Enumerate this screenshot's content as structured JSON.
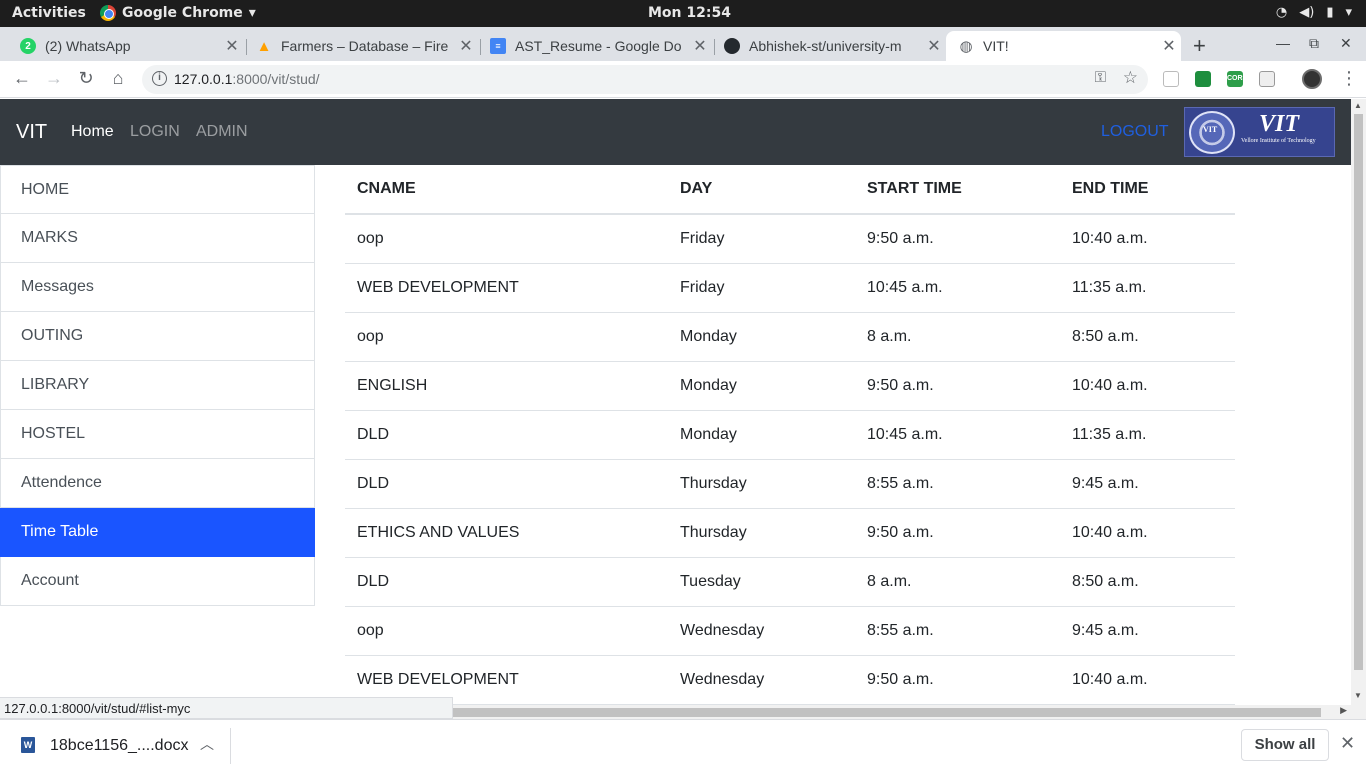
{
  "system_bar": {
    "activities": "Activities",
    "app_menu": "Google Chrome",
    "clock": "Mon 12:54"
  },
  "tabs": [
    {
      "title": "(2) WhatsApp",
      "badge": "2"
    },
    {
      "title": "Farmers – Database – Fire"
    },
    {
      "title": "AST_Resume - Google Do"
    },
    {
      "title": "Abhishek-st/university-m"
    },
    {
      "title": "VIT!"
    }
  ],
  "address_bar": {
    "url_host": "127.0.0.1",
    "url_rest": ":8000/vit/stud/"
  },
  "extensions": {
    "cors_label": "CORS"
  },
  "navbar": {
    "brand": "VIT",
    "links": [
      "Home",
      "LOGIN",
      "ADMIN"
    ],
    "logout": "LOGOUT",
    "logo_text": "VIT",
    "logo_subtitle": "Vellore Institute of Technology",
    "logo_seal_text": "VIT"
  },
  "sidebar": {
    "items": [
      "HOME",
      "MARKS",
      "Messages",
      "OUTING",
      "LIBRARY",
      "HOSTEL",
      "Attendence",
      "Time Table",
      "Account"
    ],
    "active": "Time Table"
  },
  "timetable": {
    "headers": [
      "CNAME",
      "DAY",
      "START TIME",
      "END TIME"
    ],
    "rows": [
      [
        "oop",
        "Friday",
        "9:50 a.m.",
        "10:40 a.m."
      ],
      [
        "WEB DEVELOPMENT",
        "Friday",
        "10:45 a.m.",
        "11:35 a.m."
      ],
      [
        "oop",
        "Monday",
        "8 a.m.",
        "8:50 a.m."
      ],
      [
        "ENGLISH",
        "Monday",
        "9:50 a.m.",
        "10:40 a.m."
      ],
      [
        "DLD",
        "Monday",
        "10:45 a.m.",
        "11:35 a.m."
      ],
      [
        "DLD",
        "Thursday",
        "8:55 a.m.",
        "9:45 a.m."
      ],
      [
        "ETHICS AND VALUES",
        "Thursday",
        "9:50 a.m.",
        "10:40 a.m."
      ],
      [
        "DLD",
        "Tuesday",
        "8 a.m.",
        "8:50 a.m."
      ],
      [
        "oop",
        "Wednesday",
        "8:55 a.m.",
        "9:45 a.m."
      ],
      [
        "WEB DEVELOPMENT",
        "Wednesday",
        "9:50 a.m.",
        "10:40 a.m."
      ]
    ]
  },
  "status_url": "127.0.0.1:8000/vit/stud/#list-myc",
  "download": {
    "filename": "18bce1156_....docx",
    "show_all": "Show all"
  },
  "colors": {
    "navbar_bg": "#343a40",
    "active_item": "#1a55ff",
    "logout": "#1f5fe0"
  }
}
